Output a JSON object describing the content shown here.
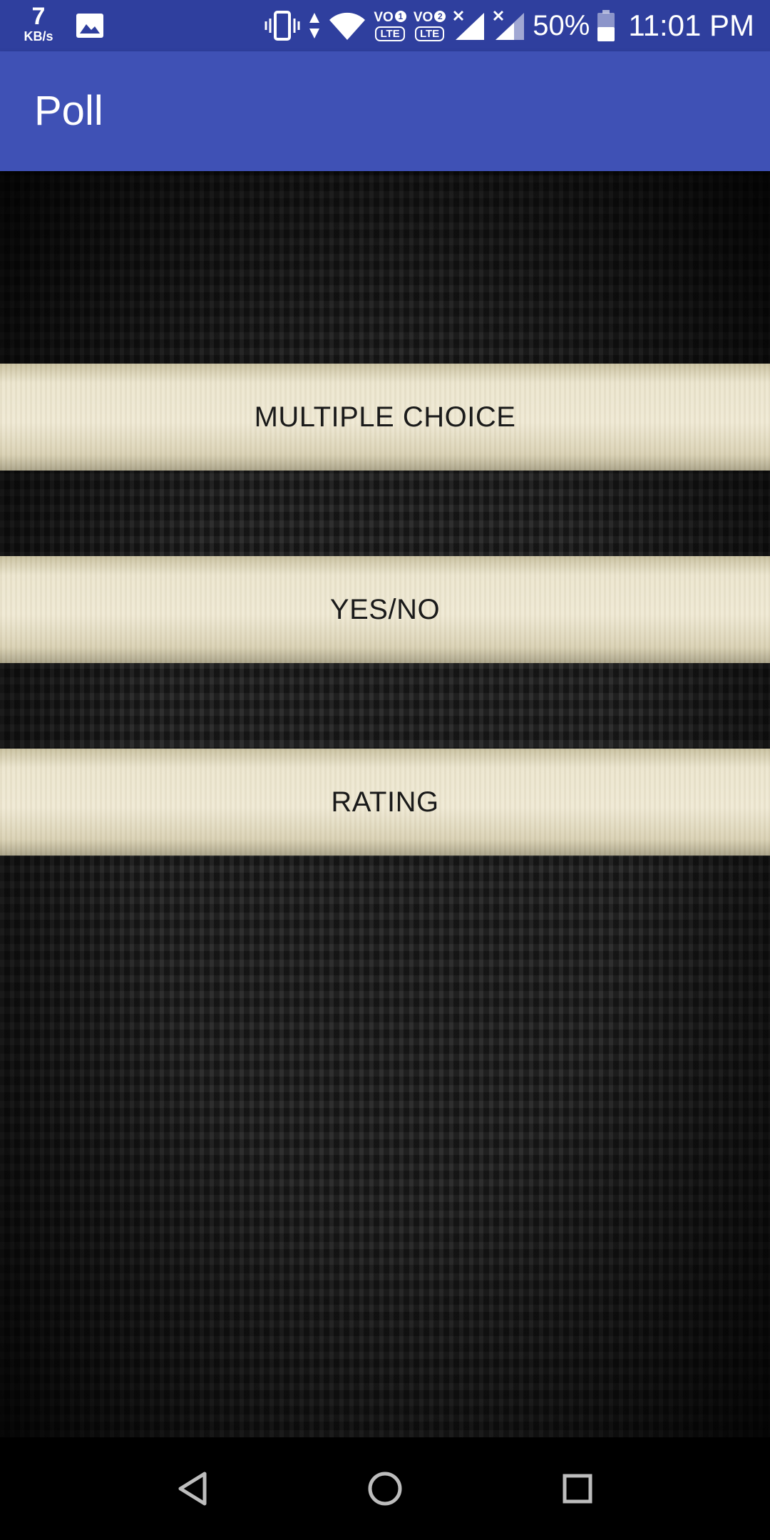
{
  "status_bar": {
    "speed_value": "7",
    "speed_unit": "KB/s",
    "sim1_label": "VO",
    "sim1_index": "1",
    "sim1_tech": "LTE",
    "sim2_label": "VO",
    "sim2_index": "2",
    "sim2_tech": "LTE",
    "battery_percent": "50%",
    "time": "11:01 PM"
  },
  "app_bar": {
    "title": "Poll"
  },
  "poll_types": [
    {
      "label": "MULTIPLE CHOICE"
    },
    {
      "label": "YES/NO"
    },
    {
      "label": "RATING"
    }
  ],
  "nav_bar": {
    "back_icon": "triangle-back-icon",
    "home_icon": "circle-home-icon",
    "recents_icon": "square-recents-icon"
  },
  "colors": {
    "status_bar": "#2f3f9e",
    "app_bar": "#3f51b5",
    "button_face": "#ece6cf",
    "button_text": "#1a1a1a"
  }
}
